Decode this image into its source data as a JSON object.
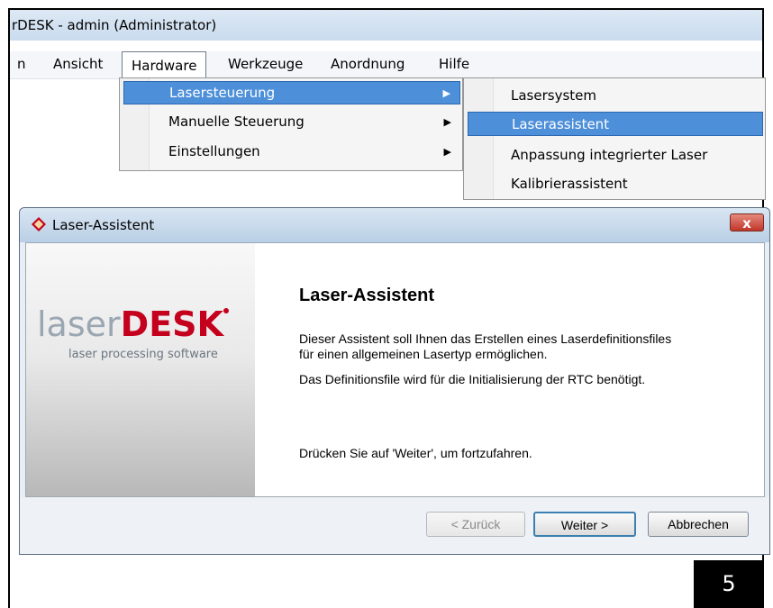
{
  "window": {
    "title": "rDESK - admin (Administrator)"
  },
  "menubar": {
    "items": [
      "n",
      "Ansicht",
      "Hardware",
      "Werkzeuge",
      "Anordnung",
      "Hilfe"
    ],
    "active": "Hardware"
  },
  "hardware_menu": {
    "items": [
      "Lasersteuerung",
      "Manuelle Steuerung",
      "Einstellungen"
    ],
    "highlighted": "Lasersteuerung"
  },
  "laser_submenu": {
    "items": [
      "Lasersystem",
      "Laserassistent",
      "Anpassung integrierter Laser",
      "Kalibrierassistent"
    ],
    "highlighted": "Laserassistent"
  },
  "dialog": {
    "title": "Laser-Assistent",
    "close_label": "x",
    "logo_light": "laser",
    "logo_bold": "DESK",
    "tagline": "laser processing software",
    "heading": "Laser-Assistent",
    "paragraph1_line1": "Dieser Assistent soll Ihnen das Erstellen eines Laserdefinitionsfiles",
    "paragraph1_line2": "für einen allgemeinen Lasertyp ermöglichen.",
    "paragraph2": "Das Definitionsfile wird für die Initialisierung der RTC benötigt.",
    "paragraph3": "Drücken Sie auf 'Weiter', um fortzufahren.",
    "buttons": {
      "back": "< Zurück",
      "next": "Weiter >",
      "cancel": "Abbrechen"
    }
  },
  "step_badge": "5",
  "colors": {
    "highlight": "#4d8fd9",
    "logo_red": "#c4001d",
    "close_red": "#c0362a"
  }
}
